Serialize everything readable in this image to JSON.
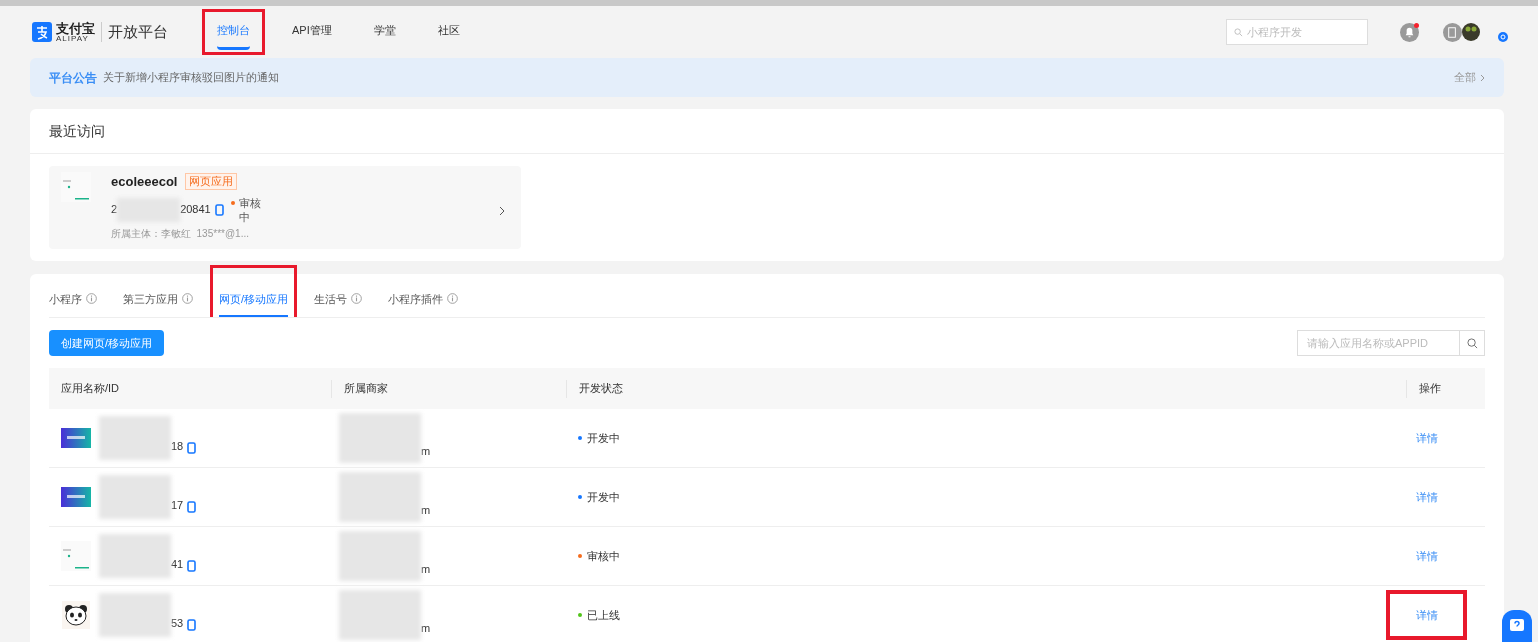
{
  "header": {
    "logo_text": "支付宝",
    "logo_subtext": "ALIPAY",
    "platform": "开放平台",
    "nav": [
      {
        "label": "控制台",
        "selected": true,
        "highlighted": true
      },
      {
        "label": "API管理",
        "selected": false,
        "highlighted": false
      },
      {
        "label": "学堂",
        "selected": false,
        "highlighted": false
      },
      {
        "label": "社区",
        "selected": false,
        "highlighted": false
      }
    ],
    "search": {
      "placeholder": "小程序开发"
    },
    "notification_unread": true
  },
  "notice": {
    "title": "平台公告",
    "text": "关于新增小程序审核驳回图片的通知",
    "more": "全部"
  },
  "recent": {
    "title": "最近访问",
    "items": [
      {
        "name": "ecoleeecol",
        "tag": "网页应用",
        "id_head": "2",
        "id_tail": "20841",
        "status": "审核中",
        "color": "#f56c1d",
        "owner": "所属主体：李敏红  135***@1..."
      }
    ]
  },
  "apps": {
    "tabs": [
      {
        "label": "小程序",
        "selected": false,
        "info": true,
        "highlighted": false
      },
      {
        "label": "第三方应用",
        "selected": false,
        "info": true,
        "highlighted": false
      },
      {
        "label": "网页/移动应用",
        "selected": true,
        "info": false,
        "highlighted": true
      },
      {
        "label": "生活号",
        "selected": false,
        "info": true,
        "highlighted": false
      },
      {
        "label": "小程序插件",
        "selected": false,
        "info": true,
        "highlighted": false
      }
    ],
    "create_button": "创建网页/移动应用",
    "search": {
      "placeholder": "请输入应用名称或APPID"
    },
    "columns": [
      "应用名称/ID",
      "所属商家",
      "开发状态",
      "操作"
    ],
    "rows": [
      {
        "kind": "banner",
        "id_tail": "18",
        "merchant_tail": "m",
        "status": "开发中",
        "color": "#1677ff",
        "action": "详情",
        "highlighted": false
      },
      {
        "kind": "banner",
        "id_tail": "17",
        "merchant_tail": "m",
        "status": "开发中",
        "color": "#1677ff",
        "action": "详情",
        "highlighted": false
      },
      {
        "kind": "screen",
        "id_tail": "41",
        "merchant_tail": "m",
        "status": "审核中",
        "color": "#f56c1d",
        "action": "详情",
        "highlighted": false
      },
      {
        "kind": "panda",
        "id_tail": "53",
        "merchant_tail": "m",
        "status": "已上线",
        "color": "#52c41a",
        "action": "详情",
        "highlighted": true
      }
    ]
  }
}
